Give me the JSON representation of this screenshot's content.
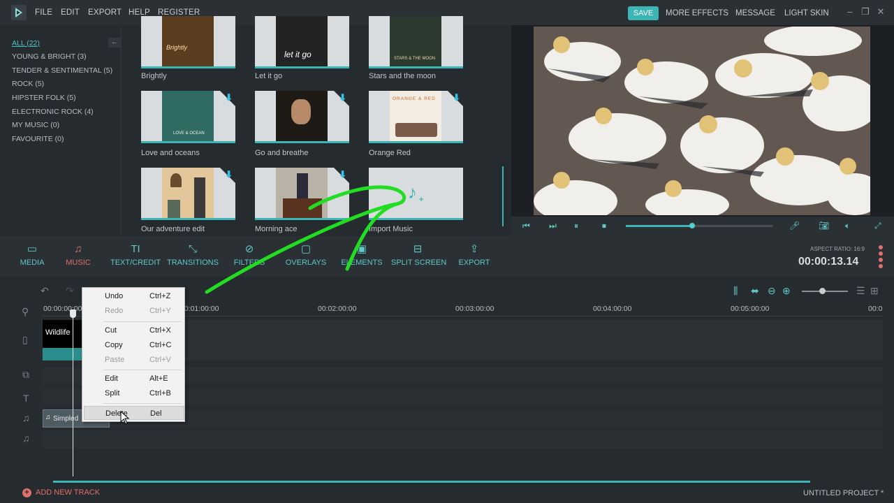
{
  "titlebar": {
    "menu": [
      "FILE",
      "EDIT",
      "EXPORT",
      "HELP",
      "REGISTER"
    ],
    "save": "SAVE",
    "right_menu": [
      "MORE EFFECTS",
      "MESSAGE",
      "LIGHT SKIN"
    ]
  },
  "categories": [
    "ALL (22)",
    "YOUNG & BRIGHT (3)",
    "TENDER & SENTIMENTAL (5)",
    "ROCK (5)",
    "HIPSTER FOLK (5)",
    "ELECTRONIC ROCK (4)",
    "MY MUSIC (0)",
    "FAVOURITE (0)"
  ],
  "library": {
    "tiles": [
      {
        "label": "Brightly",
        "art_text": "Brightly"
      },
      {
        "label": "Let it go",
        "art_text": "let it go"
      },
      {
        "label": "Stars and the moon",
        "art_text": "STARS & THE MOON"
      },
      {
        "label": "Love and oceans",
        "art_text": "LOVE & OCEAN"
      },
      {
        "label": "Go and breathe",
        "art_text": ""
      },
      {
        "label": "Orange Red",
        "art_text": "ORANGE & RED"
      },
      {
        "label": "Our adventure edit",
        "art_text": ""
      },
      {
        "label": "Morning ace",
        "art_text": ""
      },
      {
        "label": "Import Music",
        "art_text": ""
      }
    ]
  },
  "toolbar": {
    "tools": [
      "MEDIA",
      "MUSIC",
      "TEXT/CREDIT",
      "TRANSITIONS",
      "FILTERS",
      "OVERLAYS",
      "ELEMENTS",
      "SPLIT SCREEN",
      "EXPORT"
    ],
    "aspect_ratio": "ASPECT RATIO: 16:9",
    "timecode": "00:00:13.14"
  },
  "timeline": {
    "ruler": [
      "00:00:00:00",
      "00:01:00:00",
      "00:02:00:00",
      "00:03:00:00",
      "00:04:00:00",
      "00:05:00:00",
      "00:0"
    ],
    "video_clip": "Wildlife",
    "audio_clip": "Simpled",
    "add_track": "ADD NEW TRACK",
    "project": "UNTITLED PROJECT *"
  },
  "player": {
    "progress": 0.45
  },
  "context_menu": [
    {
      "label": "Undo",
      "shortcut": "Ctrl+Z",
      "enabled": true
    },
    {
      "label": "Redo",
      "shortcut": "Ctrl+Y",
      "enabled": false
    },
    {
      "label": "Cut",
      "shortcut": "Ctrl+X",
      "enabled": true
    },
    {
      "label": "Copy",
      "shortcut": "Ctrl+C",
      "enabled": true
    },
    {
      "label": "Paste",
      "shortcut": "Ctrl+V",
      "enabled": false
    },
    {
      "label": "Edit",
      "shortcut": "Alt+E",
      "enabled": true
    },
    {
      "label": "Split",
      "shortcut": "Ctrl+B",
      "enabled": true
    },
    {
      "label": "Delete",
      "shortcut": "Del",
      "enabled": true
    }
  ],
  "colors": {
    "accent": "#3bb6b4",
    "active": "#e0706a",
    "annotation": "#22dd22"
  }
}
